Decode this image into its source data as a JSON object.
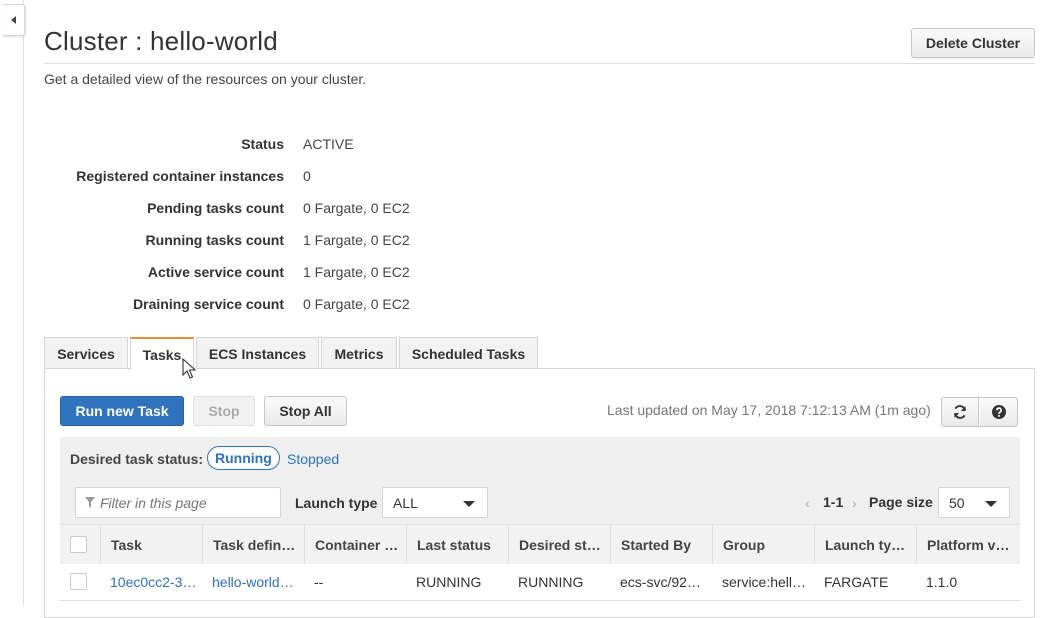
{
  "page": {
    "title": "Cluster : hello-world",
    "subtitle": "Get a detailed view of the resources on your cluster.",
    "delete_button": "Delete Cluster"
  },
  "details": [
    {
      "label": "Status",
      "value": "ACTIVE"
    },
    {
      "label": "Registered container instances",
      "value": "0"
    },
    {
      "label": "Pending tasks count",
      "value": "0 Fargate, 0 EC2"
    },
    {
      "label": "Running tasks count",
      "value": "1 Fargate, 0 EC2"
    },
    {
      "label": "Active service count",
      "value": "1 Fargate, 0 EC2"
    },
    {
      "label": "Draining service count",
      "value": "0 Fargate, 0 EC2"
    }
  ],
  "tabs": [
    {
      "label": "Services",
      "active": false
    },
    {
      "label": "Tasks",
      "active": true
    },
    {
      "label": "ECS Instances",
      "active": false
    },
    {
      "label": "Metrics",
      "active": false
    },
    {
      "label": "Scheduled Tasks",
      "active": false
    }
  ],
  "toolbar": {
    "run_new_task": "Run new Task",
    "stop": "Stop",
    "stop_all": "Stop All",
    "last_updated": "Last updated on May 17, 2018 7:12:13 AM (1m ago)",
    "refresh_icon": "refresh-icon",
    "help_icon": "help-icon"
  },
  "filters": {
    "desired_status_label": "Desired task status:",
    "running": "Running",
    "stopped": "Stopped",
    "filter_placeholder": "Filter in this page",
    "launch_type_label": "Launch type",
    "launch_type_value": "ALL",
    "pager_prev": "‹",
    "pager_range": "1-1",
    "pager_next": "›",
    "page_size_label": "Page size",
    "page_size_value": "50"
  },
  "table": {
    "columns": [
      "Task",
      "Task defin…",
      "Container …",
      "Last status",
      "Desired st…",
      "Started By",
      "Group",
      "Launch ty…",
      "Platform v…"
    ],
    "rows": [
      [
        "10ec0cc2-3…",
        "hello-world…",
        "--",
        "RUNNING",
        "RUNNING",
        "ecs-svc/92…",
        "service:hell…",
        "FARGATE",
        "1.1.0"
      ]
    ]
  },
  "colors": {
    "accent_blue": "#2f72bd",
    "active_tab_orange": "#e88a3a"
  }
}
